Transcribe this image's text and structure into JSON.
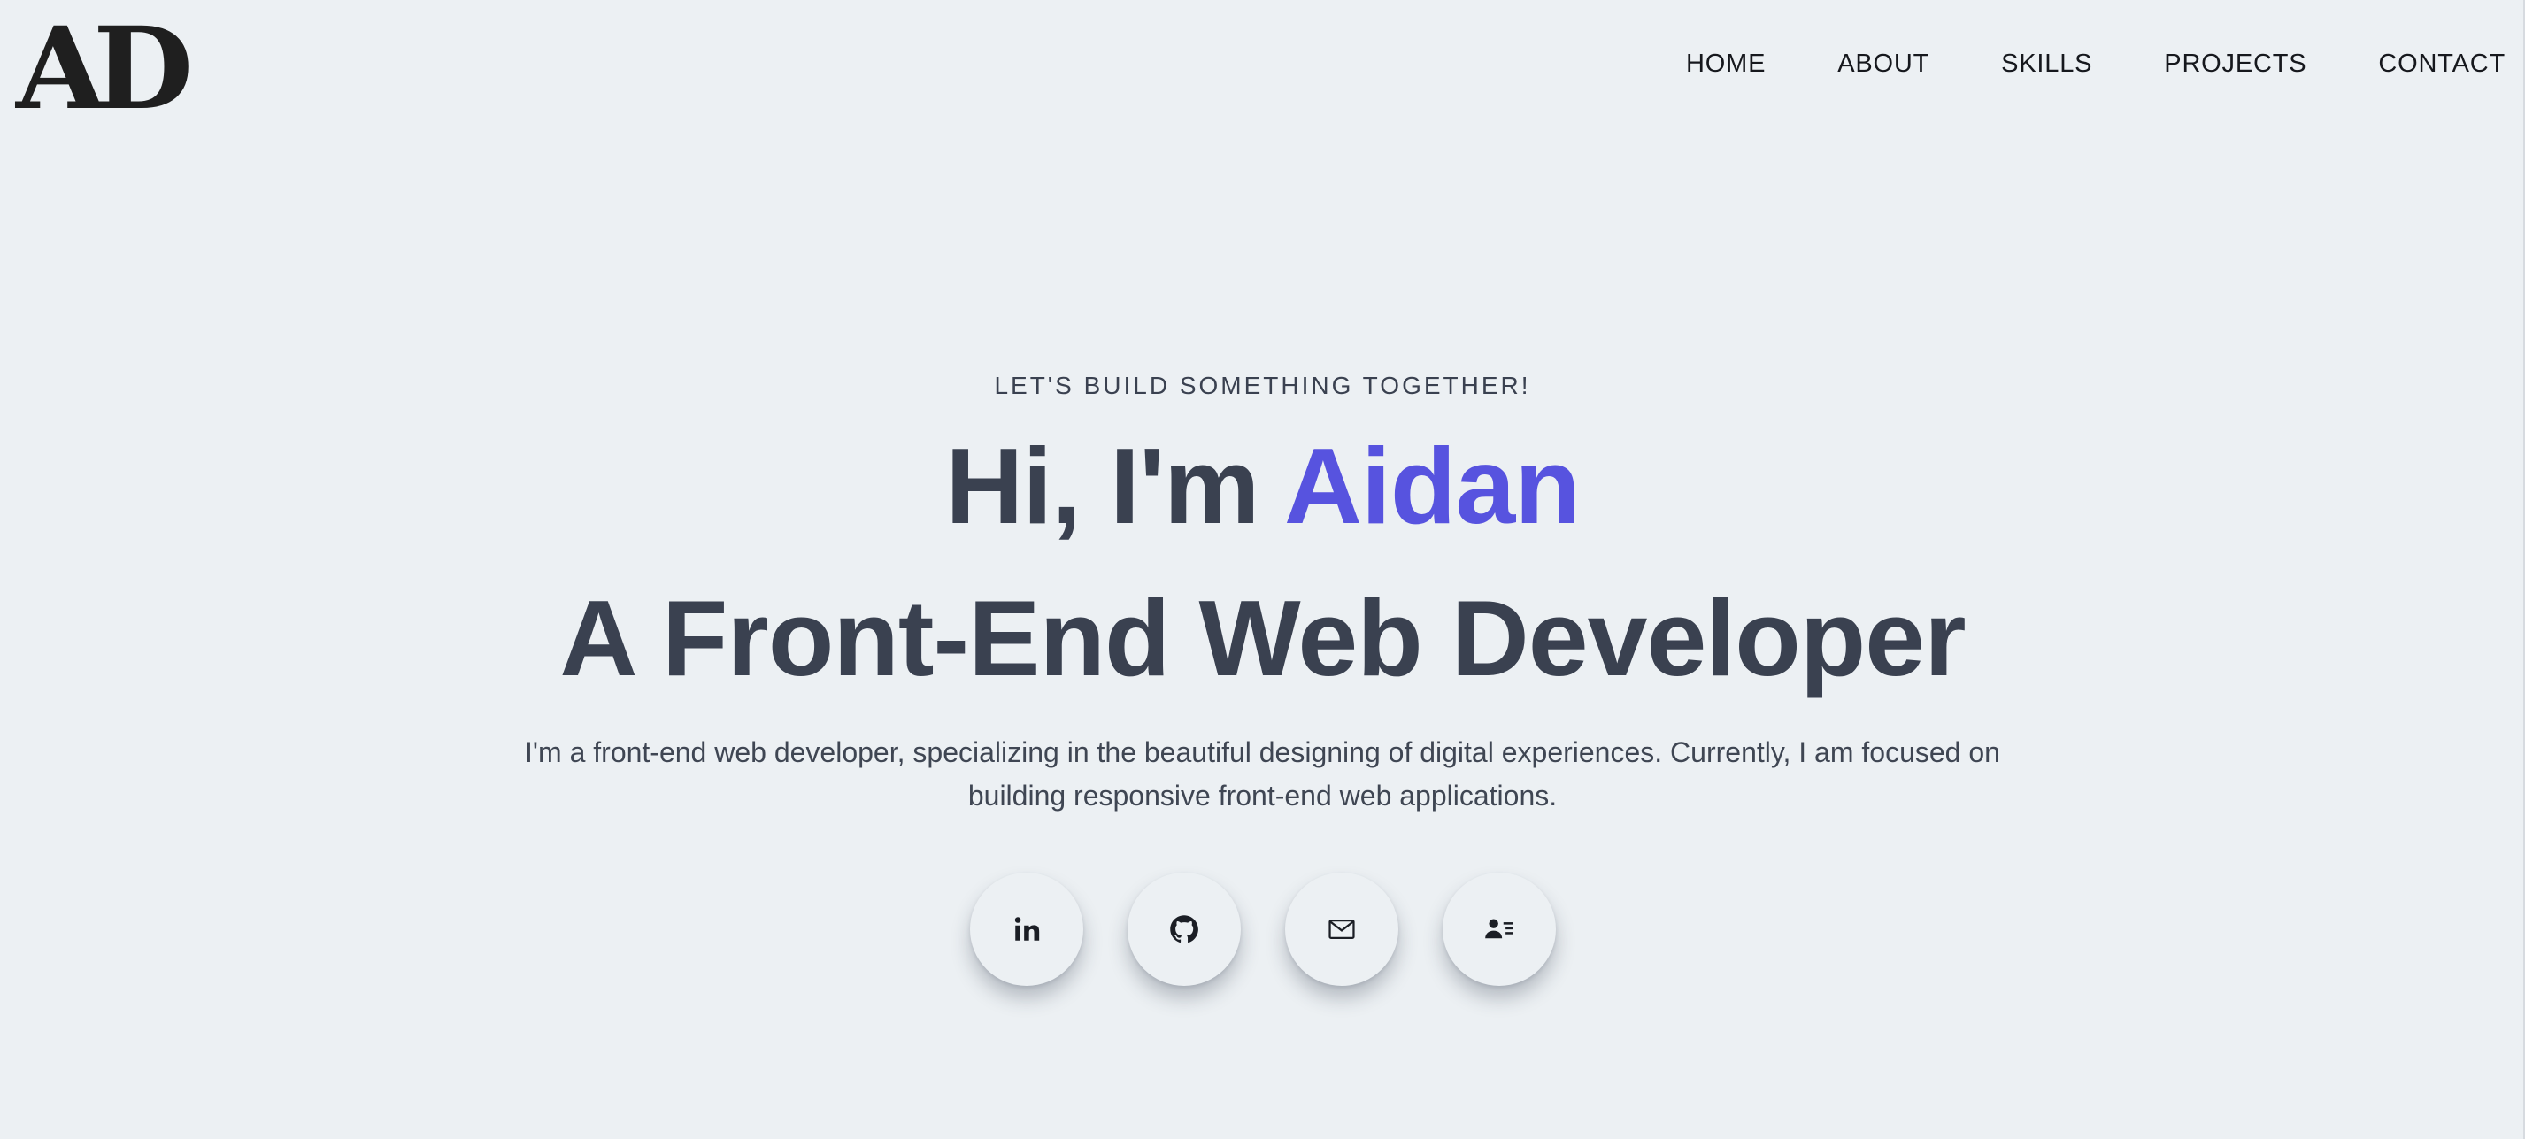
{
  "header": {
    "logo_text": "AD",
    "nav": [
      {
        "label": "HOME"
      },
      {
        "label": "ABOUT"
      },
      {
        "label": "SKILLS"
      },
      {
        "label": "PROJECTS"
      },
      {
        "label": "CONTACT"
      }
    ]
  },
  "hero": {
    "eyebrow": "LET'S BUILD SOMETHING TOGETHER!",
    "greeting": "Hi, I'm",
    "name": "Aidan",
    "role": "A Front-End Web Developer",
    "intro": "I'm a front-end web developer, specializing in the beautiful designing of digital experiences. Currently, I am focused on building responsive front-end web applications."
  },
  "socials": [
    {
      "icon": "linkedin-icon"
    },
    {
      "icon": "github-icon"
    },
    {
      "icon": "mail-icon"
    },
    {
      "icon": "contact-card-icon"
    }
  ],
  "colors": {
    "background": "#ecf0f3",
    "text": "#3a4150",
    "accent": "#5753df",
    "logo": "#1f1f1f"
  }
}
